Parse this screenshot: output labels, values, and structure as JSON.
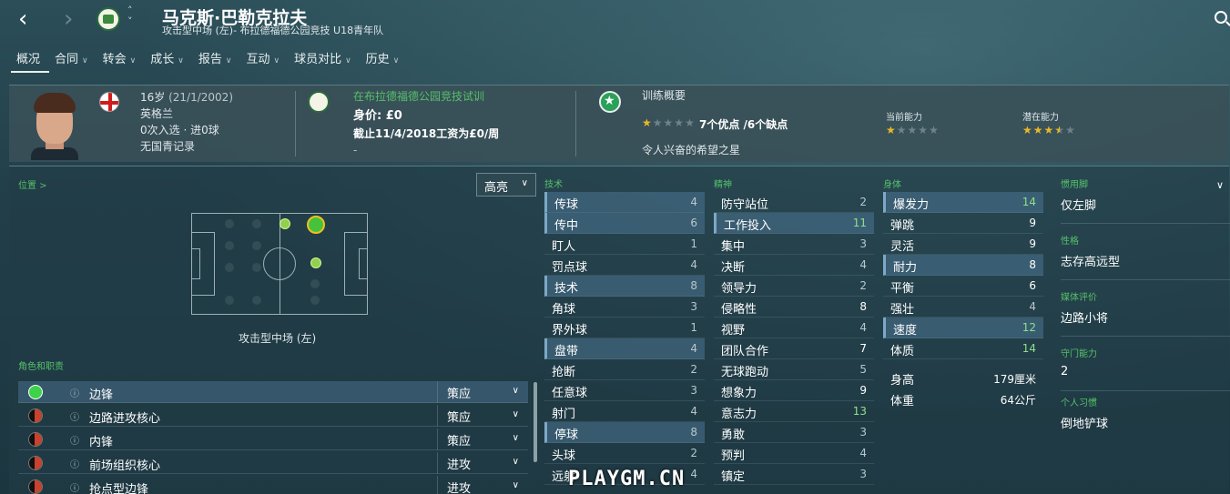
{
  "header": {
    "player_name": "马克斯·巴勒克拉夫",
    "subtitle": "攻击型中场 (左)- 布拉德福德公园竞技  U18青年队",
    "back_icon": "chevron-left-icon",
    "forward_icon": "chevron-right-icon",
    "search_icon": "search-icon"
  },
  "tabs": [
    {
      "label": "概况",
      "active": true
    },
    {
      "label": "合同"
    },
    {
      "label": "转会"
    },
    {
      "label": "成长"
    },
    {
      "label": "报告"
    },
    {
      "label": "互动"
    },
    {
      "label": "球员对比"
    },
    {
      "label": "历史"
    }
  ],
  "info": {
    "age": "16岁",
    "dob": "(21/1/2002)",
    "nationality": "英格兰",
    "caps": "0次入选 · 进0球",
    "youth_record": "无国青记录",
    "trial": "在布拉德福德公园竞技试训",
    "value": "身价: £0",
    "wage": "截止11/4/2018工资为£0/周",
    "dash": "-",
    "training_title": "训练概要",
    "strengths": "7个优点 /6个缺点",
    "training_rating": 1,
    "star_max": 5,
    "description": "令人兴奋的希望之星",
    "current_ability_label": "当前能力",
    "current_ability_stars": 1,
    "potential_ability_label": "潜在能力",
    "potential_ability_stars": 3.5
  },
  "position": {
    "link": "位置 >",
    "highlight_select": "高亮",
    "caption": "攻击型中场 (左)"
  },
  "roles": {
    "title": "角色和职责",
    "items": [
      {
        "name": "边锋",
        "duty": "策应",
        "suitability": "full"
      },
      {
        "name": "边路进攻核心",
        "duty": "策应",
        "suitability": "half"
      },
      {
        "name": "内锋",
        "duty": "策应",
        "suitability": "half"
      },
      {
        "name": "前场组织核心",
        "duty": "进攻",
        "suitability": "half"
      },
      {
        "name": "抢点型边锋",
        "duty": "进攻",
        "suitability": "half"
      }
    ]
  },
  "attributes": {
    "technical_title": "技术",
    "mental_title": "精神",
    "physical_title": "身体",
    "technical": [
      {
        "name": "传球",
        "value": "4",
        "hl": true
      },
      {
        "name": "传中",
        "value": "6",
        "hl": true
      },
      {
        "name": "盯人",
        "value": "1"
      },
      {
        "name": "罚点球",
        "value": "4"
      },
      {
        "name": "技术",
        "value": "8",
        "hl": true
      },
      {
        "name": "角球",
        "value": "3"
      },
      {
        "name": "界外球",
        "value": "1"
      },
      {
        "name": "盘带",
        "value": "4",
        "hl": true
      },
      {
        "name": "抢断",
        "value": "2"
      },
      {
        "name": "任意球",
        "value": "3"
      },
      {
        "name": "射门",
        "value": "4"
      },
      {
        "name": "停球",
        "value": "8",
        "hl": true
      },
      {
        "name": "头球",
        "value": "2"
      },
      {
        "name": "远射",
        "value": "4"
      }
    ],
    "mental": [
      {
        "name": "防守站位",
        "value": "2"
      },
      {
        "name": "工作投入",
        "value": "11",
        "hl": true,
        "good": true
      },
      {
        "name": "集中",
        "value": "3"
      },
      {
        "name": "决断",
        "value": "4"
      },
      {
        "name": "领导力",
        "value": "2"
      },
      {
        "name": "侵略性",
        "value": "8",
        "white": true
      },
      {
        "name": "视野",
        "value": "4"
      },
      {
        "name": "团队合作",
        "value": "7",
        "white": true
      },
      {
        "name": "无球跑动",
        "value": "5"
      },
      {
        "name": "想象力",
        "value": "9",
        "white": true
      },
      {
        "name": "意志力",
        "value": "13",
        "good": true
      },
      {
        "name": "勇敢",
        "value": "3"
      },
      {
        "name": "预判",
        "value": "4"
      },
      {
        "name": "镇定",
        "value": "3"
      }
    ],
    "physical": [
      {
        "name": "爆发力",
        "value": "14",
        "hl": true,
        "good": true
      },
      {
        "name": "弹跳",
        "value": "9",
        "white": true
      },
      {
        "name": "灵活",
        "value": "9",
        "white": true
      },
      {
        "name": "耐力",
        "value": "8",
        "hl": true,
        "white": true
      },
      {
        "name": "平衡",
        "value": "6",
        "white": true
      },
      {
        "name": "强壮",
        "value": "4"
      },
      {
        "name": "速度",
        "value": "12",
        "hl": true,
        "good": true
      },
      {
        "name": "体质",
        "value": "14",
        "good": true
      }
    ],
    "height_label": "身高",
    "height": "179厘米",
    "weight_label": "体重",
    "weight": "64公斤"
  },
  "side": {
    "foot_label": "惯用脚",
    "foot": "仅左脚",
    "personality_label": "性格",
    "personality": "志存高远型",
    "media_label": "媒体评价",
    "media": "边路小将",
    "gk_label": "守门能力",
    "gk": "2",
    "habits_label": "个人习惯",
    "habits": "倒地铲球"
  },
  "watermark": "PLAYGM.CN",
  "colors": {
    "accent_green": "#55c06a",
    "highlight_row": "#48708c",
    "good_value": "#8fe08a",
    "star": "#e8b829"
  }
}
